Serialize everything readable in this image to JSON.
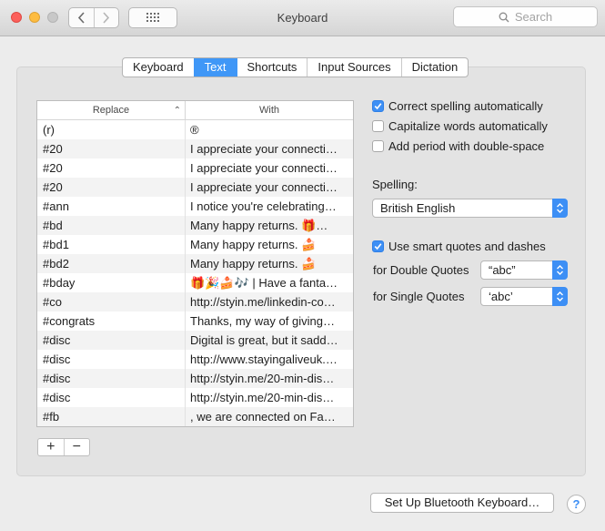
{
  "window": {
    "title": "Keyboard"
  },
  "toolbar": {
    "search_placeholder": "Search"
  },
  "tabs": [
    "Keyboard",
    "Text",
    "Shortcuts",
    "Input Sources",
    "Dictation"
  ],
  "active_tab": "Text",
  "table": {
    "headers": {
      "replace": "Replace",
      "with": "With"
    },
    "rows": [
      {
        "replace": "(r)",
        "with": "®"
      },
      {
        "replace": "#20",
        "with": "I appreciate your connecti…"
      },
      {
        "replace": "#20",
        "with": "I appreciate your connecti…"
      },
      {
        "replace": "#20",
        "with": "I appreciate your connecti…"
      },
      {
        "replace": "#ann",
        "with": "I notice you're celebrating…"
      },
      {
        "replace": "#bd",
        "with": "Many happy returns. 🎁…"
      },
      {
        "replace": "#bd1",
        "with": "Many happy returns. 🍰"
      },
      {
        "replace": "#bd2",
        "with": "Many happy returns. 🍰"
      },
      {
        "replace": "#bday",
        "with": "🎁🎉🍰🎶 | Have a fanta…"
      },
      {
        "replace": "#co",
        "with": "http://styin.me/linkedin-co…"
      },
      {
        "replace": "#congrats",
        "with": "Thanks, my way of giving…"
      },
      {
        "replace": "#disc",
        "with": "Digital is great, but it sadd…"
      },
      {
        "replace": "#disc",
        "with": "http://www.stayingaliveuk.…"
      },
      {
        "replace": "#disc",
        "with": "http://styin.me/20-min-dis…"
      },
      {
        "replace": "#disc",
        "with": "http://styin.me/20-min-dis…"
      },
      {
        "replace": "#fb",
        "with": " , we are connected on Fa…"
      }
    ],
    "add_label": "+",
    "remove_label": "−"
  },
  "options": {
    "correct_spelling": {
      "label": "Correct spelling automatically",
      "checked": true
    },
    "capitalize_words": {
      "label": "Capitalize words automatically",
      "checked": false
    },
    "add_period": {
      "label": "Add period with double-space",
      "checked": false
    },
    "spelling_label": "Spelling:",
    "spelling_value": "British English",
    "smart_quotes": {
      "label": "Use smart quotes and dashes",
      "checked": true
    },
    "double_quotes_label": "for Double Quotes",
    "double_quotes_value": "“abc”",
    "single_quotes_label": "for Single Quotes",
    "single_quotes_value": "‘abc’"
  },
  "footer": {
    "bluetooth_button": "Set Up Bluetooth Keyboard…",
    "help_label": "?"
  },
  "colors": {
    "accent": "#3d8ff5",
    "close": "#fc605b",
    "minimize": "#fdbc40",
    "zoom": "#c8c8c8"
  }
}
